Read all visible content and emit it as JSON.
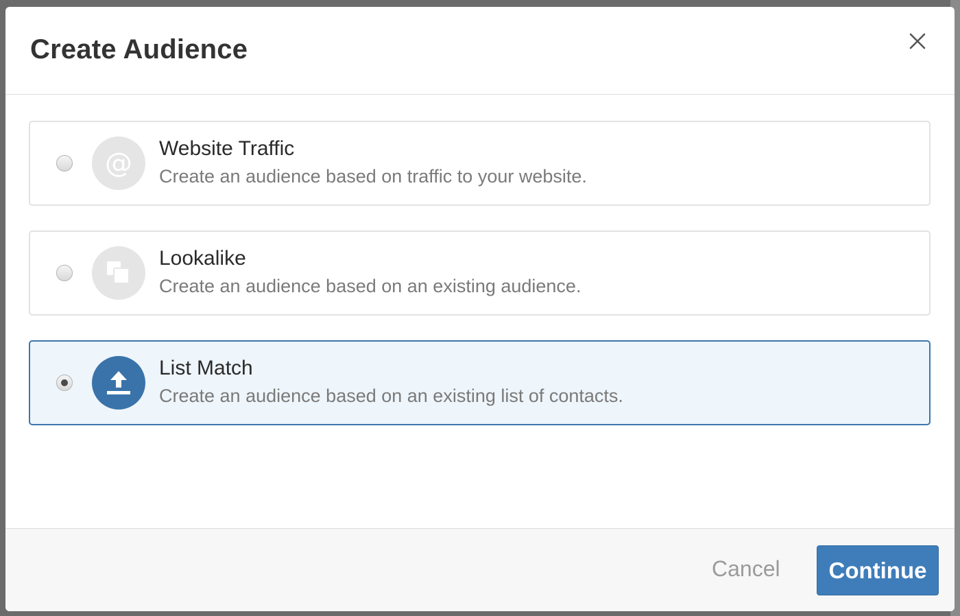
{
  "modal": {
    "title": "Create Audience",
    "close_icon": "close-icon"
  },
  "options": [
    {
      "title": "Website Traffic",
      "description": "Create an audience based on traffic to your website.",
      "icon": "at-sign-icon",
      "selected": false
    },
    {
      "title": "Lookalike",
      "description": "Create an audience based on an existing audience.",
      "icon": "duplicate-icon",
      "selected": false
    },
    {
      "title": "List Match",
      "description": "Create an audience based on an existing list of contacts.",
      "icon": "upload-icon",
      "selected": true
    }
  ],
  "footer": {
    "cancel_label": "Cancel",
    "continue_label": "Continue"
  },
  "colors": {
    "accent": "#3f7dba",
    "selected_background": "#eef5fb",
    "selected_border": "#3d77ac",
    "inactive_icon_bg": "#e5e5e5"
  }
}
